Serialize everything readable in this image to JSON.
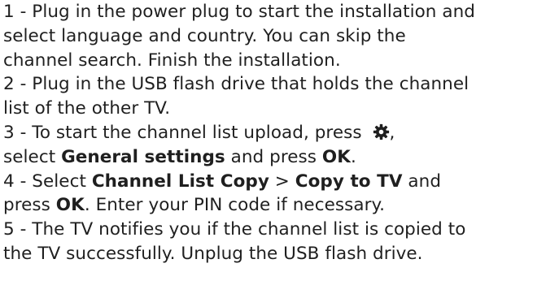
{
  "steps": {
    "s1_line1": "1 -  Plug in the power plug to start the installation and",
    "s1_line2": "select language and country. You can skip the",
    "s1_line3": "channel search. Finish the installation.",
    "s2_line1": "2 -  Plug in the USB flash drive that holds the channel",
    "s2_line2": "list of the other TV.",
    "s3_line1_prefix": "3 -  To start the channel list upload, press ",
    "s3_line1_suffix": ",",
    "s3_line2_prefix": "select ",
    "s3_line2_bold1": "General settings",
    "s3_line2_mid": " and press  ",
    "s3_line2_bold2": "OK",
    "s3_line2_suffix": ".",
    "s4_line1_prefix": "4 -  Select  ",
    "s4_line1_bold1": "Channel List Copy",
    "s4_line1_mid": " >  ",
    "s4_line1_bold2": "Copy to TV",
    "s4_line1_suffix": " and",
    "s4_line2_prefix": "press  ",
    "s4_line2_bold": "OK",
    "s4_line2_suffix": ". Enter your PIN code if necessary.",
    "s5_line1": "5 -  The TV notifies you if the channel list is copied to",
    "s5_line2": "the TV successfully. Unplug the USB flash drive."
  },
  "icons": {
    "settings": "gear-icon"
  },
  "colors": {
    "text": "#1f1f1f",
    "background": "#ffffff"
  }
}
